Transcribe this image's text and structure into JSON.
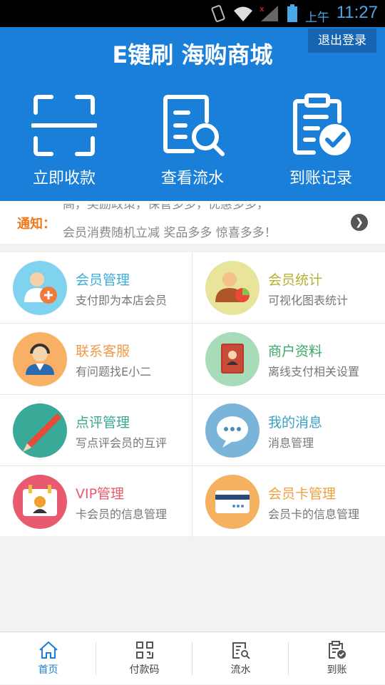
{
  "statusbar": {
    "ampm": "上午",
    "time": "11:27"
  },
  "header": {
    "title": "E键刷 海购商城",
    "logout_label": "退出登录",
    "actions": [
      {
        "label": "立即收款",
        "icon": "scan-icon"
      },
      {
        "label": "查看流水",
        "icon": "statement-search-icon"
      },
      {
        "label": "到账记录",
        "icon": "clipboard-check-icon"
      }
    ]
  },
  "notice": {
    "label": "通知：",
    "line1": "高，奖励政策，保管多多，优惠多多，",
    "line2": "会员消费随机立减   奖品多多   惊喜多多！"
  },
  "menu": [
    {
      "title": "会员管理",
      "subtitle": "支付即为本店会员",
      "color": "#3aaed8",
      "bg": "#7fd3ee",
      "icon": "member-add-icon"
    },
    {
      "title": "会员统计",
      "subtitle": "可视化图表统计",
      "color": "#b4b030",
      "bg": "#e8e49a",
      "icon": "member-stats-icon"
    },
    {
      "title": "联系客服",
      "subtitle": "有问题找E小二",
      "color": "#f09a4a",
      "bg": "#f7b065",
      "icon": "customer-service-icon"
    },
    {
      "title": "商户资料",
      "subtitle": "离线支付相关设置",
      "color": "#3aa86a",
      "bg": "#a8dcb8",
      "icon": "merchant-book-icon"
    },
    {
      "title": "点评管理",
      "subtitle": "写点评会员的互评",
      "color": "#3aa890",
      "bg": "#3aaa98",
      "icon": "pencil-icon"
    },
    {
      "title": "我的消息",
      "subtitle": "消息管理",
      "color": "#3aa0c8",
      "bg": "#7ab4d8",
      "icon": "message-bubble-icon"
    },
    {
      "title": "VIP管理",
      "subtitle": "卡会员的信息管理",
      "color": "#e85a70",
      "bg": "#e85a70",
      "icon": "vip-calendar-icon"
    },
    {
      "title": "会员卡管理",
      "subtitle": "会员卡的信息管理",
      "color": "#f0a040",
      "bg": "#f5b060",
      "icon": "member-card-icon"
    }
  ],
  "tabs": [
    {
      "label": "首页",
      "icon": "home-icon",
      "active": true
    },
    {
      "label": "付款码",
      "icon": "qr-code-icon",
      "active": false
    },
    {
      "label": "流水",
      "icon": "statement-icon",
      "active": false
    },
    {
      "label": "到账",
      "icon": "arrival-icon",
      "active": false
    }
  ]
}
